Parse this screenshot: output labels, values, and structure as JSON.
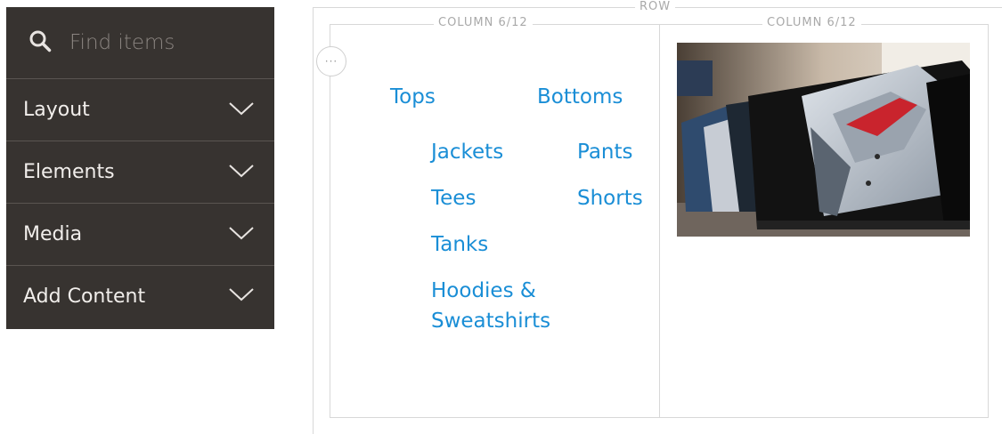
{
  "sidebar": {
    "search": {
      "placeholder": "Find items",
      "icon": "search-icon"
    },
    "items": [
      {
        "label": "Layout",
        "icon": "chevron-down-icon"
      },
      {
        "label": "Elements",
        "icon": "chevron-down-icon"
      },
      {
        "label": "Media",
        "icon": "chevron-down-icon"
      },
      {
        "label": "Add Content",
        "icon": "chevron-down-icon"
      }
    ]
  },
  "stage": {
    "row_label": "ROW",
    "columns": [
      {
        "label": "COLUMN 6/12",
        "links": {
          "tops": "Tops",
          "bottoms": "Bottoms",
          "jackets": "Jackets",
          "pants": "Pants",
          "tees": "Tees",
          "shorts": "Shorts",
          "tanks": "Tanks",
          "hoodies_line1": "Hoodies &",
          "hoodies_line2": "Sweatshirts"
        }
      },
      {
        "label": "COLUMN 6/12"
      }
    ],
    "handle": "···"
  },
  "colors": {
    "panel_bg": "#373330",
    "link": "#1a8ed6",
    "border": "#d8d8d8"
  }
}
